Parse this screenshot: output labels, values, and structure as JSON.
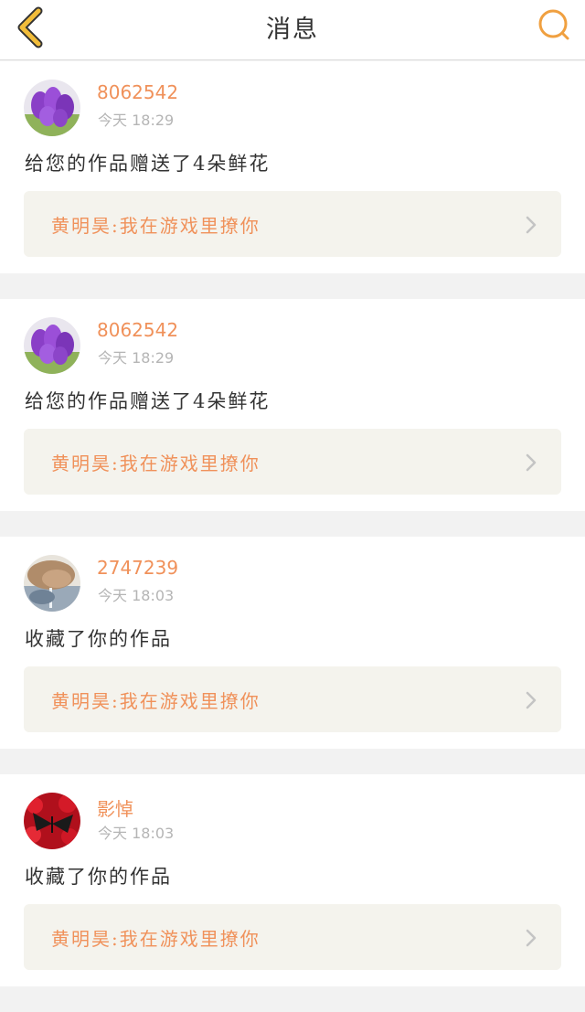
{
  "header": {
    "title": "消息",
    "back_icon": "chevron-left-icon",
    "search_icon": "search-icon",
    "accent": "#f0a040"
  },
  "colors": {
    "accent_text": "#f0915a",
    "muted": "#b5b5b5",
    "card_bg": "#ffffff",
    "link_bg": "#f4f3ed"
  },
  "messages": [
    {
      "user": "8062542",
      "time": "今天 18:29",
      "action": "给您的作品赠送了4朵鲜花",
      "work": "黄明昊:我在游戏里撩你",
      "avatar": "purple-tulips"
    },
    {
      "user": "8062542",
      "time": "今天 18:29",
      "action": "给您的作品赠送了4朵鲜花",
      "work": "黄明昊:我在游戏里撩你",
      "avatar": "purple-tulips"
    },
    {
      "user": "2747239",
      "time": "今天 18:03",
      "action": "收藏了你的作品",
      "work": "黄明昊:我在游戏里撩你",
      "avatar": "portrait-photo"
    },
    {
      "user": "影悼",
      "time": "今天 18:03",
      "action": "收藏了你的作品",
      "work": "黄明昊:我在游戏里撩你",
      "avatar": "red-flowers-butterfly"
    }
  ]
}
